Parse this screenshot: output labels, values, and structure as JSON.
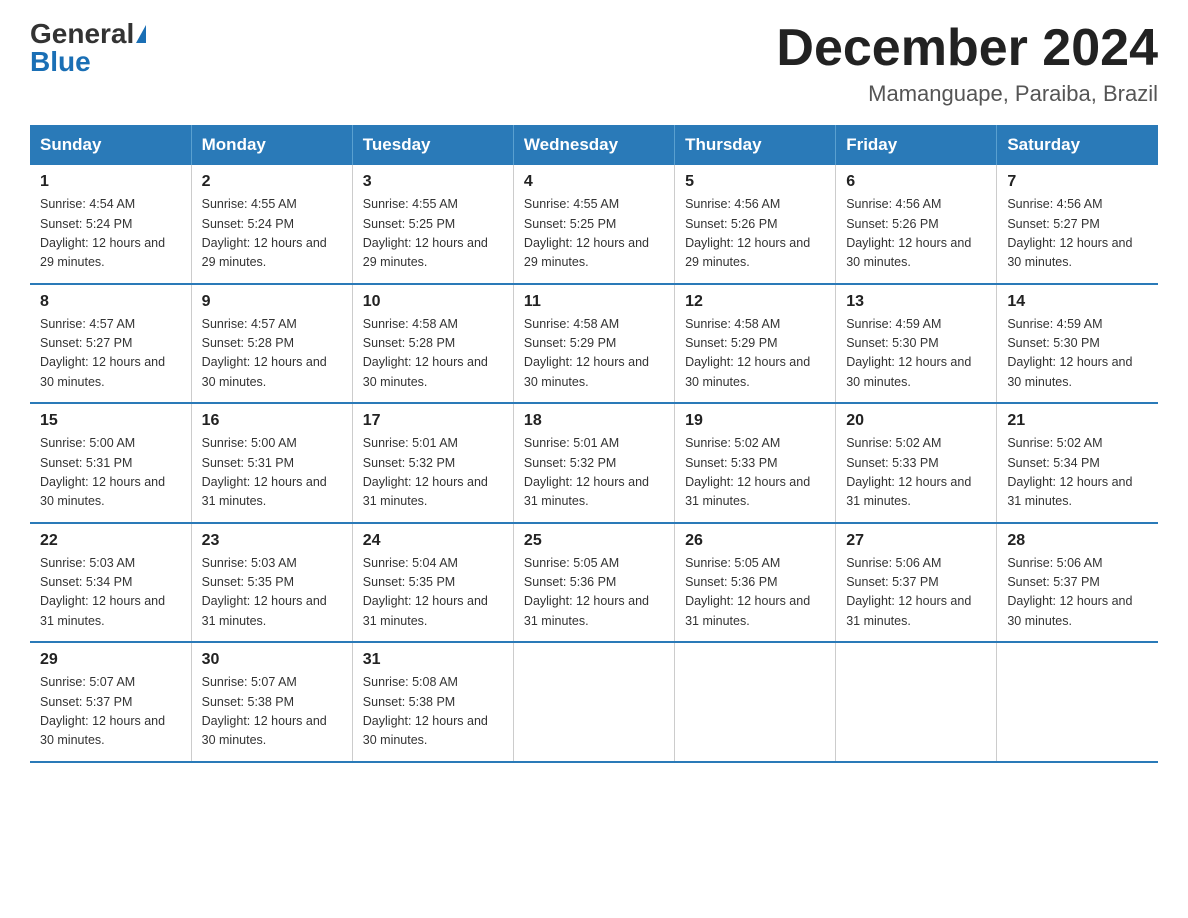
{
  "header": {
    "logo_general": "General",
    "logo_blue": "Blue",
    "month_title": "December 2024",
    "location": "Mamanguape, Paraiba, Brazil"
  },
  "columns": [
    "Sunday",
    "Monday",
    "Tuesday",
    "Wednesday",
    "Thursday",
    "Friday",
    "Saturday"
  ],
  "weeks": [
    [
      {
        "day": "1",
        "sunrise": "Sunrise: 4:54 AM",
        "sunset": "Sunset: 5:24 PM",
        "daylight": "Daylight: 12 hours and 29 minutes."
      },
      {
        "day": "2",
        "sunrise": "Sunrise: 4:55 AM",
        "sunset": "Sunset: 5:24 PM",
        "daylight": "Daylight: 12 hours and 29 minutes."
      },
      {
        "day": "3",
        "sunrise": "Sunrise: 4:55 AM",
        "sunset": "Sunset: 5:25 PM",
        "daylight": "Daylight: 12 hours and 29 minutes."
      },
      {
        "day": "4",
        "sunrise": "Sunrise: 4:55 AM",
        "sunset": "Sunset: 5:25 PM",
        "daylight": "Daylight: 12 hours and 29 minutes."
      },
      {
        "day": "5",
        "sunrise": "Sunrise: 4:56 AM",
        "sunset": "Sunset: 5:26 PM",
        "daylight": "Daylight: 12 hours and 29 minutes."
      },
      {
        "day": "6",
        "sunrise": "Sunrise: 4:56 AM",
        "sunset": "Sunset: 5:26 PM",
        "daylight": "Daylight: 12 hours and 30 minutes."
      },
      {
        "day": "7",
        "sunrise": "Sunrise: 4:56 AM",
        "sunset": "Sunset: 5:27 PM",
        "daylight": "Daylight: 12 hours and 30 minutes."
      }
    ],
    [
      {
        "day": "8",
        "sunrise": "Sunrise: 4:57 AM",
        "sunset": "Sunset: 5:27 PM",
        "daylight": "Daylight: 12 hours and 30 minutes."
      },
      {
        "day": "9",
        "sunrise": "Sunrise: 4:57 AM",
        "sunset": "Sunset: 5:28 PM",
        "daylight": "Daylight: 12 hours and 30 minutes."
      },
      {
        "day": "10",
        "sunrise": "Sunrise: 4:58 AM",
        "sunset": "Sunset: 5:28 PM",
        "daylight": "Daylight: 12 hours and 30 minutes."
      },
      {
        "day": "11",
        "sunrise": "Sunrise: 4:58 AM",
        "sunset": "Sunset: 5:29 PM",
        "daylight": "Daylight: 12 hours and 30 minutes."
      },
      {
        "day": "12",
        "sunrise": "Sunrise: 4:58 AM",
        "sunset": "Sunset: 5:29 PM",
        "daylight": "Daylight: 12 hours and 30 minutes."
      },
      {
        "day": "13",
        "sunrise": "Sunrise: 4:59 AM",
        "sunset": "Sunset: 5:30 PM",
        "daylight": "Daylight: 12 hours and 30 minutes."
      },
      {
        "day": "14",
        "sunrise": "Sunrise: 4:59 AM",
        "sunset": "Sunset: 5:30 PM",
        "daylight": "Daylight: 12 hours and 30 minutes."
      }
    ],
    [
      {
        "day": "15",
        "sunrise": "Sunrise: 5:00 AM",
        "sunset": "Sunset: 5:31 PM",
        "daylight": "Daylight: 12 hours and 30 minutes."
      },
      {
        "day": "16",
        "sunrise": "Sunrise: 5:00 AM",
        "sunset": "Sunset: 5:31 PM",
        "daylight": "Daylight: 12 hours and 31 minutes."
      },
      {
        "day": "17",
        "sunrise": "Sunrise: 5:01 AM",
        "sunset": "Sunset: 5:32 PM",
        "daylight": "Daylight: 12 hours and 31 minutes."
      },
      {
        "day": "18",
        "sunrise": "Sunrise: 5:01 AM",
        "sunset": "Sunset: 5:32 PM",
        "daylight": "Daylight: 12 hours and 31 minutes."
      },
      {
        "day": "19",
        "sunrise": "Sunrise: 5:02 AM",
        "sunset": "Sunset: 5:33 PM",
        "daylight": "Daylight: 12 hours and 31 minutes."
      },
      {
        "day": "20",
        "sunrise": "Sunrise: 5:02 AM",
        "sunset": "Sunset: 5:33 PM",
        "daylight": "Daylight: 12 hours and 31 minutes."
      },
      {
        "day": "21",
        "sunrise": "Sunrise: 5:02 AM",
        "sunset": "Sunset: 5:34 PM",
        "daylight": "Daylight: 12 hours and 31 minutes."
      }
    ],
    [
      {
        "day": "22",
        "sunrise": "Sunrise: 5:03 AM",
        "sunset": "Sunset: 5:34 PM",
        "daylight": "Daylight: 12 hours and 31 minutes."
      },
      {
        "day": "23",
        "sunrise": "Sunrise: 5:03 AM",
        "sunset": "Sunset: 5:35 PM",
        "daylight": "Daylight: 12 hours and 31 minutes."
      },
      {
        "day": "24",
        "sunrise": "Sunrise: 5:04 AM",
        "sunset": "Sunset: 5:35 PM",
        "daylight": "Daylight: 12 hours and 31 minutes."
      },
      {
        "day": "25",
        "sunrise": "Sunrise: 5:05 AM",
        "sunset": "Sunset: 5:36 PM",
        "daylight": "Daylight: 12 hours and 31 minutes."
      },
      {
        "day": "26",
        "sunrise": "Sunrise: 5:05 AM",
        "sunset": "Sunset: 5:36 PM",
        "daylight": "Daylight: 12 hours and 31 minutes."
      },
      {
        "day": "27",
        "sunrise": "Sunrise: 5:06 AM",
        "sunset": "Sunset: 5:37 PM",
        "daylight": "Daylight: 12 hours and 31 minutes."
      },
      {
        "day": "28",
        "sunrise": "Sunrise: 5:06 AM",
        "sunset": "Sunset: 5:37 PM",
        "daylight": "Daylight: 12 hours and 30 minutes."
      }
    ],
    [
      {
        "day": "29",
        "sunrise": "Sunrise: 5:07 AM",
        "sunset": "Sunset: 5:37 PM",
        "daylight": "Daylight: 12 hours and 30 minutes."
      },
      {
        "day": "30",
        "sunrise": "Sunrise: 5:07 AM",
        "sunset": "Sunset: 5:38 PM",
        "daylight": "Daylight: 12 hours and 30 minutes."
      },
      {
        "day": "31",
        "sunrise": "Sunrise: 5:08 AM",
        "sunset": "Sunset: 5:38 PM",
        "daylight": "Daylight: 12 hours and 30 minutes."
      },
      {
        "day": "",
        "sunrise": "",
        "sunset": "",
        "daylight": ""
      },
      {
        "day": "",
        "sunrise": "",
        "sunset": "",
        "daylight": ""
      },
      {
        "day": "",
        "sunrise": "",
        "sunset": "",
        "daylight": ""
      },
      {
        "day": "",
        "sunrise": "",
        "sunset": "",
        "daylight": ""
      }
    ]
  ]
}
